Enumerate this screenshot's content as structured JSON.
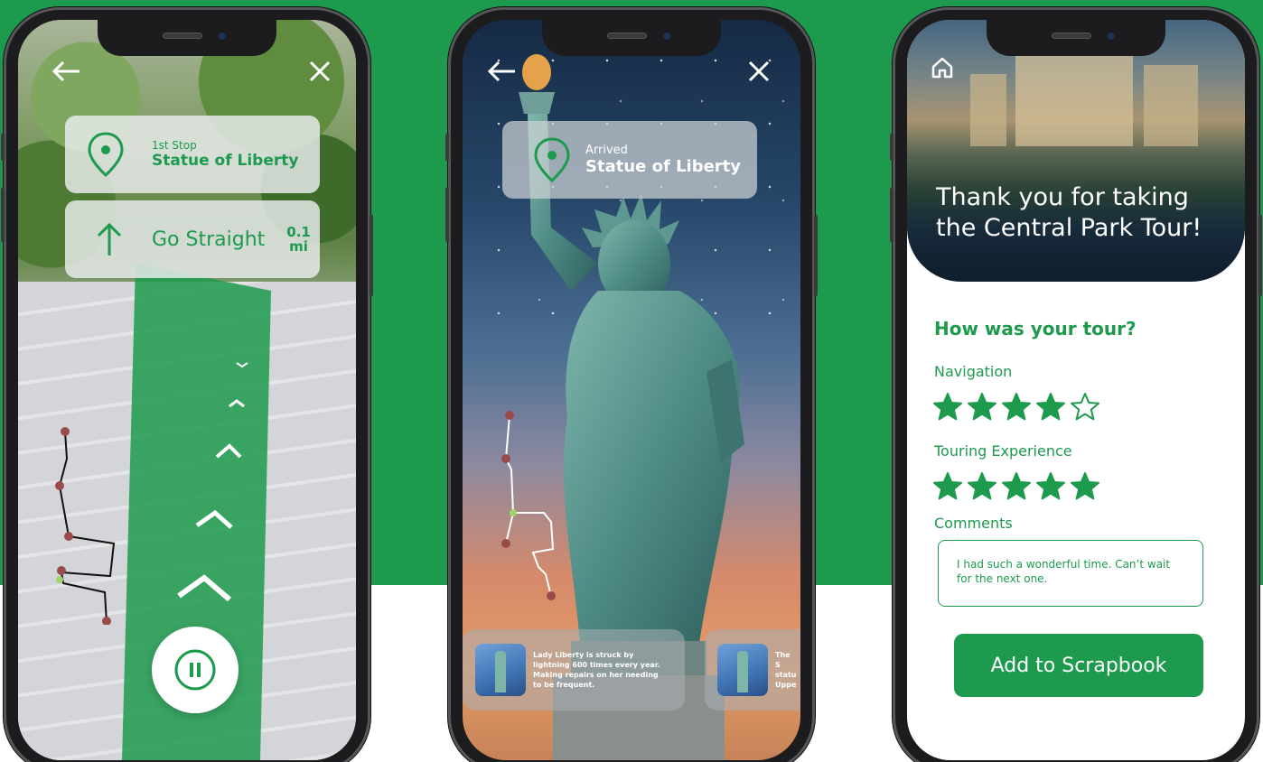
{
  "colors": {
    "brand_green": "#1d9a4e",
    "background_top": "#1d9a4e",
    "background_bottom": "#ffffff"
  },
  "phone1": {
    "stop_card": {
      "sublabel": "1st Stop",
      "title": "Statue of Liberty",
      "icon": "map-pin-icon"
    },
    "nav_card": {
      "instruction": "Go Straight",
      "distance_value": "0.1",
      "distance_unit": "mi",
      "icon": "arrow-up-icon"
    },
    "back_icon": "arrow-left-icon",
    "close_icon": "close-icon",
    "pause_icon": "pause-icon"
  },
  "phone2": {
    "arrival_card": {
      "sublabel": "Arrived",
      "title": "Statue of Liberty",
      "icon": "map-pin-icon"
    },
    "facts": [
      {
        "text": "Lady Liberty is struck by lightning 600 times every year. Making repairs on her needing to be frequent."
      },
      {
        "text": "The S statu Uppe"
      }
    ],
    "back_icon": "arrow-left-icon",
    "close_icon": "close-icon"
  },
  "phone3": {
    "home_icon": "home-icon",
    "hero_title": "Thank you for taking the Central Park Tour!",
    "survey_title": "How was your tour?",
    "ratings": [
      {
        "label": "Navigation",
        "score": 4,
        "max": 5
      },
      {
        "label": "Touring Experience",
        "score": 5,
        "max": 5
      }
    ],
    "comments_label": "Comments",
    "comment_text": "I had such a wonderful time. Can’t wait for the next one.",
    "cta_label": "Add to Scrapbook"
  }
}
